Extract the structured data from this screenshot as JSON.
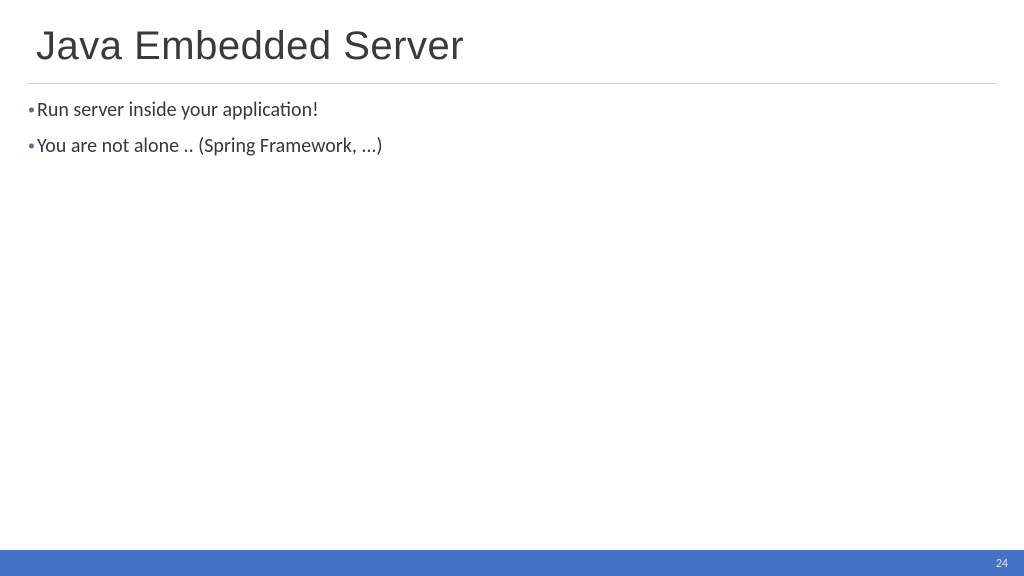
{
  "slide": {
    "title": "Java Embedded Server",
    "bullets": [
      "Run server inside your application!",
      "You are not alone .. (Spring Framework, ...)"
    ],
    "page_number": "24"
  }
}
